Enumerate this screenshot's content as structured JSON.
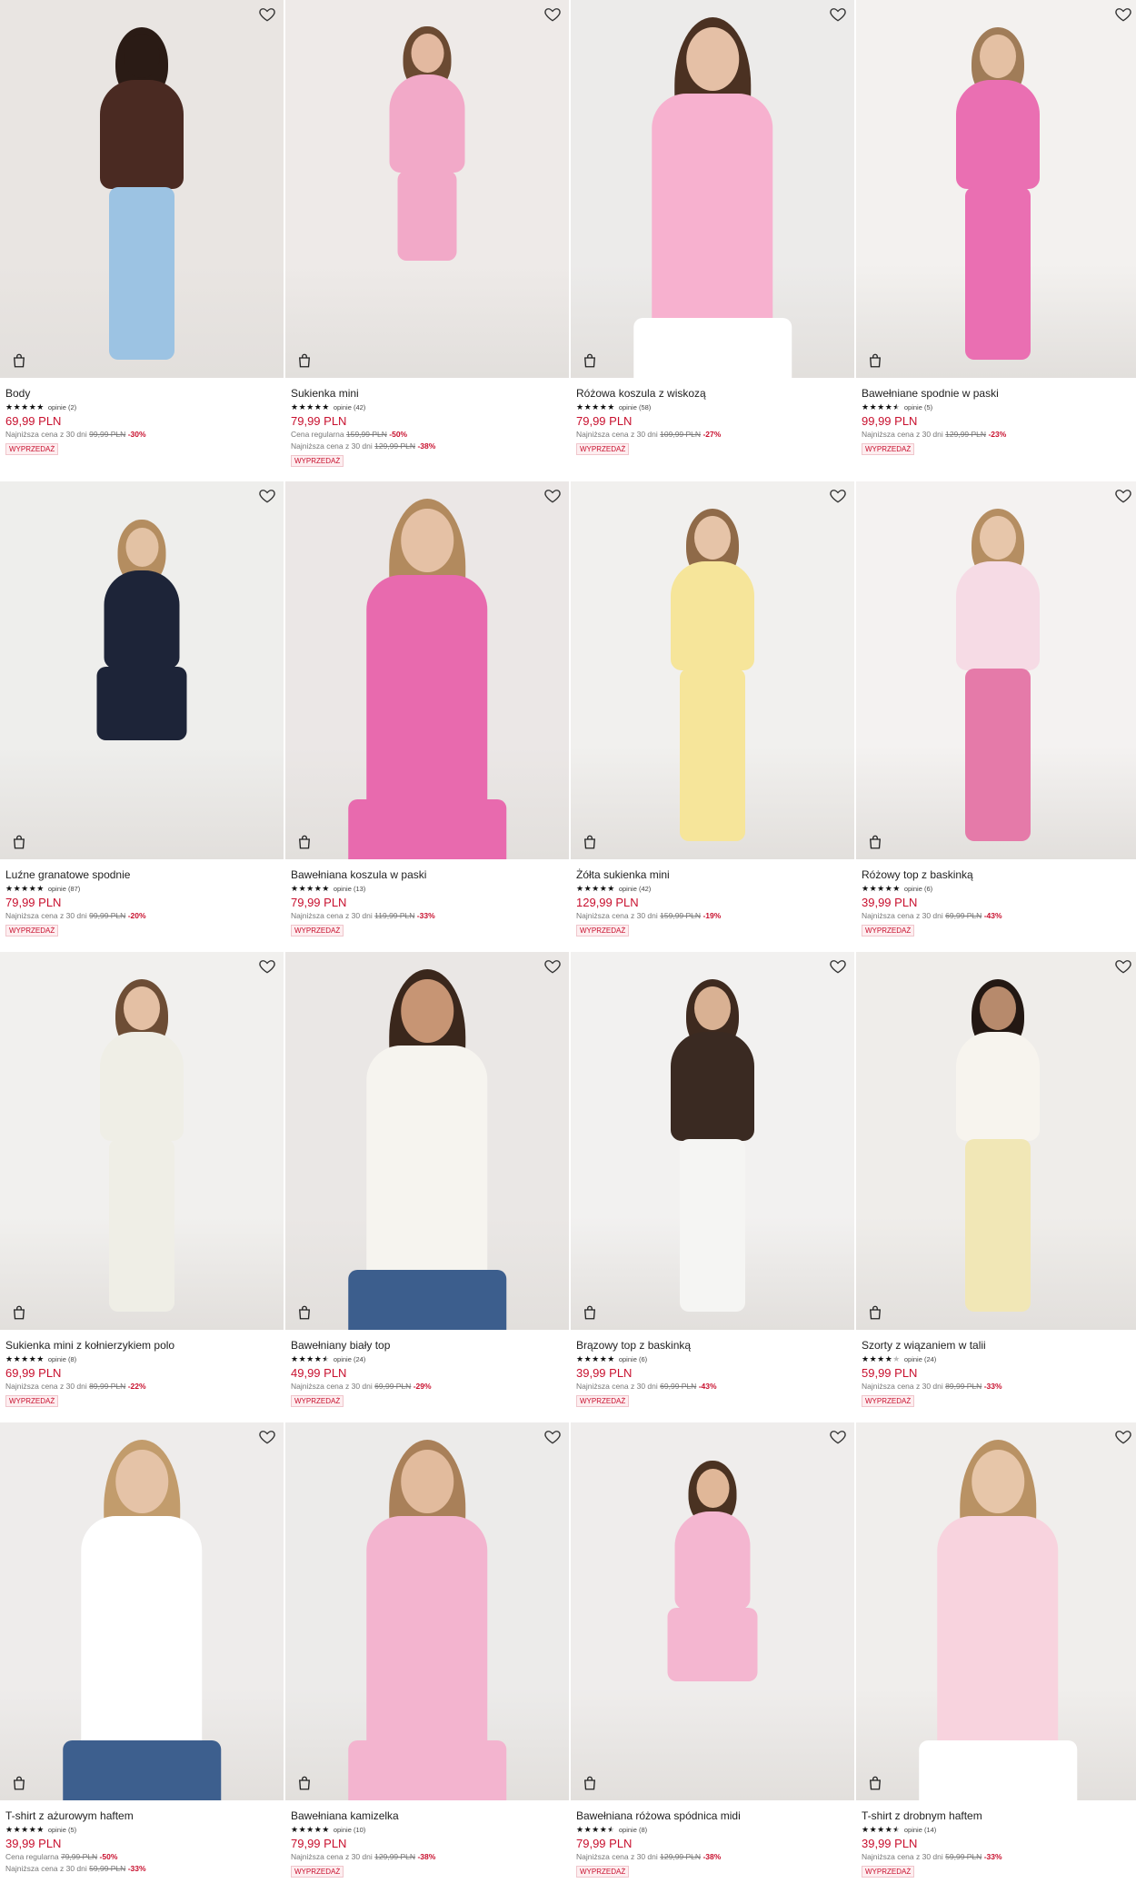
{
  "products": [
    {
      "name": "Body",
      "stars": 5,
      "reviews": "opinie (2)",
      "price": "69,99 PLN",
      "lines": [
        {
          "label": "Najniższa cena z 30 dni",
          "old": "99,99 PLN",
          "pct": "-30%"
        }
      ],
      "badge": "WYPRZEDAŻ",
      "colors": {
        "bg": "#e9e5e2",
        "top": "#4a2a22",
        "bottom": "#9cc3e3",
        "skin": "#b98266",
        "hair": "#2a1b15"
      },
      "pose": "back"
    },
    {
      "name": "Sukienka mini",
      "stars": 5,
      "reviews": "opinie (42)",
      "price": "79,99 PLN",
      "lines": [
        {
          "label": "Cena regularna",
          "old": "159,99 PLN",
          "pct": "-50%"
        },
        {
          "label": "Najniższa cena z 30 dni",
          "old": "129,99 PLN",
          "pct": "-38%"
        }
      ],
      "badge": "WYPRZEDAŻ",
      "colors": {
        "bg": "#eeeae8",
        "top": "#f2a9c8",
        "bottom": "#f2a9c8",
        "skin": "#e3b9a0",
        "hair": "#6b4a32"
      },
      "pose": "crouch"
    },
    {
      "name": "Różowa koszula z wiskozą",
      "stars": 5,
      "reviews": "opinie (58)",
      "price": "79,99 PLN",
      "lines": [
        {
          "label": "Najniższa cena z 30 dni",
          "old": "109,99 PLN",
          "pct": "-27%"
        }
      ],
      "badge": "WYPRZEDAŻ",
      "colors": {
        "bg": "#ecebea",
        "top": "#f7b1cf",
        "bottom": "#ffffff",
        "skin": "#e5c0a6",
        "hair": "#4b3122"
      },
      "pose": "close"
    },
    {
      "name": "Bawełniane spodnie w paski",
      "stars": 4.5,
      "reviews": "opinie (5)",
      "price": "99,99 PLN",
      "lines": [
        {
          "label": "Najniższa cena z 30 dni",
          "old": "129,99 PLN",
          "pct": "-23%"
        }
      ],
      "badge": "WYPRZEDAŻ",
      "colors": {
        "bg": "#f3f1ef",
        "top": "#ea6fb2",
        "bottom": "#ea6fb2",
        "skin": "#e4c0a3",
        "hair": "#a07c58"
      },
      "pose": "stand"
    },
    {
      "name": "Luźne granatowe spodnie",
      "stars": 5,
      "reviews": "opinie (87)",
      "price": "79,99 PLN",
      "lines": [
        {
          "label": "Najniższa cena z 30 dni",
          "old": "99,99 PLN",
          "pct": "-20%"
        }
      ],
      "badge": "WYPRZEDAŻ",
      "colors": {
        "bg": "#eeeeec",
        "top": "#1d2438",
        "bottom": "#1d2438",
        "skin": "#e3c2a4",
        "hair": "#b48d60"
      },
      "pose": "sit"
    },
    {
      "name": "Bawełniana koszula w paski",
      "stars": 5,
      "reviews": "opinie (13)",
      "price": "79,99 PLN",
      "lines": [
        {
          "label": "Najniższa cena z 30 dni",
          "old": "119,99 PLN",
          "pct": "-33%"
        }
      ],
      "badge": "WYPRZEDAŻ",
      "colors": {
        "bg": "#ebe7e6",
        "top": "#e86aae",
        "bottom": "#e86aae",
        "skin": "#e5c1a5",
        "hair": "#b28a5e"
      },
      "pose": "close"
    },
    {
      "name": "Żółta sukienka mini",
      "stars": 5,
      "reviews": "opinie (42)",
      "price": "129,99 PLN",
      "lines": [
        {
          "label": "Najniższa cena z 30 dni",
          "old": "159,99 PLN",
          "pct": "-19%"
        }
      ],
      "badge": "WYPRZEDAŻ",
      "colors": {
        "bg": "#f1f0ee",
        "top": "#f6e59a",
        "bottom": "#f6e59a",
        "skin": "#e6c4a8",
        "hair": "#8f6a48"
      },
      "pose": "stand"
    },
    {
      "name": "Różowy top z baskinką",
      "stars": 5,
      "reviews": "opinie (6)",
      "price": "39,99 PLN",
      "lines": [
        {
          "label": "Najniższa cena z 30 dni",
          "old": "69,99 PLN",
          "pct": "-43%"
        }
      ],
      "badge": "WYPRZEDAŻ",
      "colors": {
        "bg": "#f4f2f1",
        "top": "#f6dbe5",
        "bottom": "#e57aa9",
        "skin": "#e7c6aa",
        "hair": "#b58e62"
      },
      "pose": "stand"
    },
    {
      "name": "Sukienka mini z kołnierzykiem polo",
      "stars": 5,
      "reviews": "opinie (8)",
      "price": "69,99 PLN",
      "lines": [
        {
          "label": "Najniższa cena z 30 dni",
          "old": "89,99 PLN",
          "pct": "-22%"
        }
      ],
      "badge": "WYPRZEDAŻ",
      "colors": {
        "bg": "#f1f0ee",
        "top": "#efeee6",
        "bottom": "#efeee6",
        "skin": "#e4c0a4",
        "hair": "#6d4d35"
      },
      "pose": "stand"
    },
    {
      "name": "Bawełniany biały top",
      "stars": 4.5,
      "reviews": "opinie (24)",
      "price": "49,99 PLN",
      "lines": [
        {
          "label": "Najniższa cena z 30 dni",
          "old": "69,99 PLN",
          "pct": "-29%"
        }
      ],
      "badge": "WYPRZEDAŻ",
      "colors": {
        "bg": "#eae7e5",
        "top": "#f6f4ef",
        "bottom": "#3c5e8d",
        "skin": "#c79574",
        "hair": "#3a271c"
      },
      "pose": "close"
    },
    {
      "name": "Brązowy top z baskinką",
      "stars": 5,
      "reviews": "opinie (6)",
      "price": "39,99 PLN",
      "lines": [
        {
          "label": "Najniższa cena z 30 dni",
          "old": "69,99 PLN",
          "pct": "-43%"
        }
      ],
      "badge": "WYPRZEDAŻ",
      "colors": {
        "bg": "#f2f1f0",
        "top": "#3a2a22",
        "bottom": "#f5f5f3",
        "skin": "#d9b193",
        "hair": "#3e2a1f"
      },
      "pose": "stand"
    },
    {
      "name": "Szorty z wiązaniem w talii",
      "stars": 4,
      "reviews": "opinie (24)",
      "price": "59,99 PLN",
      "lines": [
        {
          "label": "Najniższa cena z 30 dni",
          "old": "89,99 PLN",
          "pct": "-33%"
        }
      ],
      "badge": "WYPRZEDAŻ",
      "colors": {
        "bg": "#efedea",
        "top": "#f7f4ee",
        "bottom": "#f1e7b6",
        "skin": "#b78a6c",
        "hair": "#231813"
      },
      "pose": "stand"
    },
    {
      "name": "T-shirt z ażurowym haftem",
      "stars": 5,
      "reviews": "opinie (5)",
      "price": "39,99 PLN",
      "lines": [
        {
          "label": "Cena regularna",
          "old": "79,99 PLN",
          "pct": "-50%"
        },
        {
          "label": "Najniższa cena z 30 dni",
          "old": "59,99 PLN",
          "pct": "-33%"
        }
      ],
      "badge": "",
      "colors": {
        "bg": "#eeeceb",
        "top": "#ffffff",
        "bottom": "#3d5f8e",
        "skin": "#e5c3a7",
        "hair": "#c29c6c"
      },
      "pose": "close"
    },
    {
      "name": "Bawełniana kamizelka",
      "stars": 5,
      "reviews": "opinie (10)",
      "price": "79,99 PLN",
      "lines": [
        {
          "label": "Najniższa cena z 30 dni",
          "old": "129,99 PLN",
          "pct": "-38%"
        }
      ],
      "badge": "WYPRZEDAŻ",
      "colors": {
        "bg": "#ecebea",
        "top": "#f3b4cf",
        "bottom": "#f3b4cf",
        "skin": "#e2bb9d",
        "hair": "#a98059"
      },
      "pose": "close"
    },
    {
      "name": "Bawełniana różowa spódnica midi",
      "stars": 4.5,
      "reviews": "opinie (8)",
      "price": "79,99 PLN",
      "lines": [
        {
          "label": "Najniższa cena z 30 dni",
          "old": "129,99 PLN",
          "pct": "-38%"
        }
      ],
      "badge": "WYPRZEDAŻ",
      "colors": {
        "bg": "#efedec",
        "top": "#f4b6d0",
        "bottom": "#f4b6d0",
        "skin": "#e0b798",
        "hair": "#4a3222"
      },
      "pose": "sit"
    },
    {
      "name": "T-shirt z drobnym haftem",
      "stars": 4.5,
      "reviews": "opinie (14)",
      "price": "39,99 PLN",
      "lines": [
        {
          "label": "Najniższa cena z 30 dni",
          "old": "59,99 PLN",
          "pct": "-33%"
        }
      ],
      "badge": "WYPRZEDAŻ",
      "colors": {
        "bg": "#f0eeec",
        "top": "#f8d3de",
        "bottom": "#ffffff",
        "skin": "#e7c6a9",
        "hair": "#b99264"
      },
      "pose": "close"
    }
  ]
}
